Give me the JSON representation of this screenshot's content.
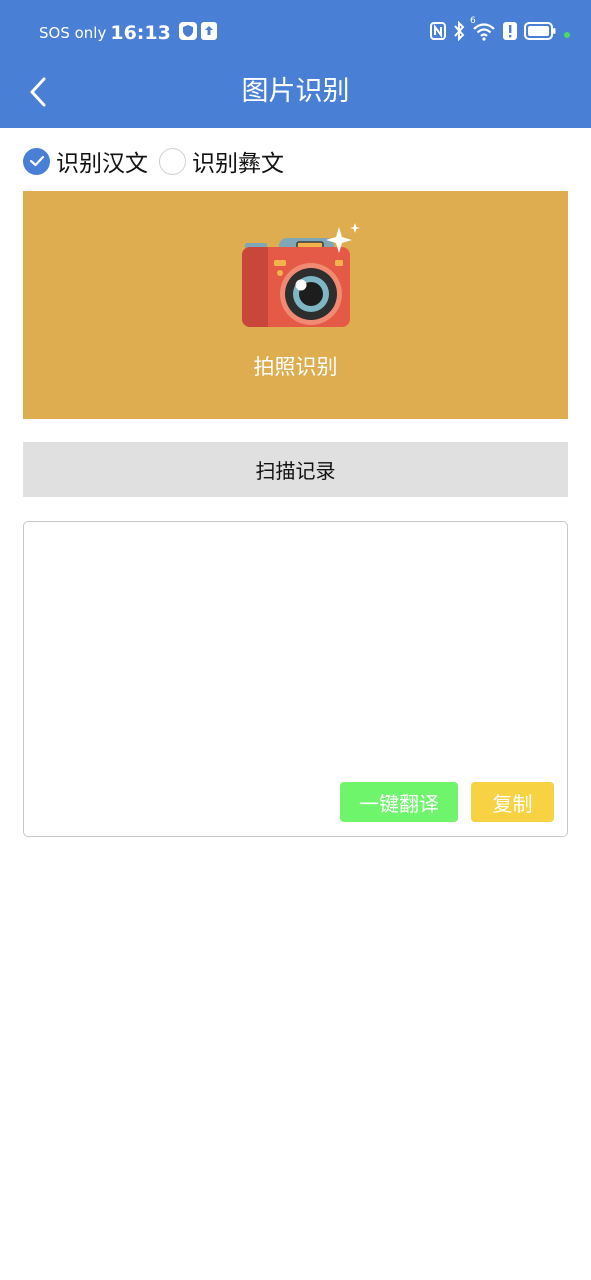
{
  "status_bar": {
    "carrier": "SOS only",
    "time": "16:13",
    "icons": [
      "shield-icon",
      "upload-icon",
      "nfc-icon",
      "bluetooth-icon",
      "wifi-icon",
      "alert-icon",
      "battery-icon",
      "dot-icon"
    ],
    "network_label": "6"
  },
  "app_bar": {
    "title": "图片识别",
    "back_icon": "chevron-left-icon"
  },
  "language_options": [
    {
      "label": "识别汉文",
      "checked": true
    },
    {
      "label": "识别彝文",
      "checked": false
    }
  ],
  "camera_panel": {
    "icon": "camera-icon",
    "label": "拍照识别"
  },
  "history_button": {
    "label": "扫描记录"
  },
  "result": {
    "text": "",
    "translate_label": "一键翻译",
    "copy_label": "复制"
  },
  "colors": {
    "primary": "#4a7fd6",
    "camera_bg": "#ddad4f",
    "history_bg": "#e0e0e0",
    "translate_bg": "#6ef56b",
    "copy_bg": "#f7d243"
  }
}
